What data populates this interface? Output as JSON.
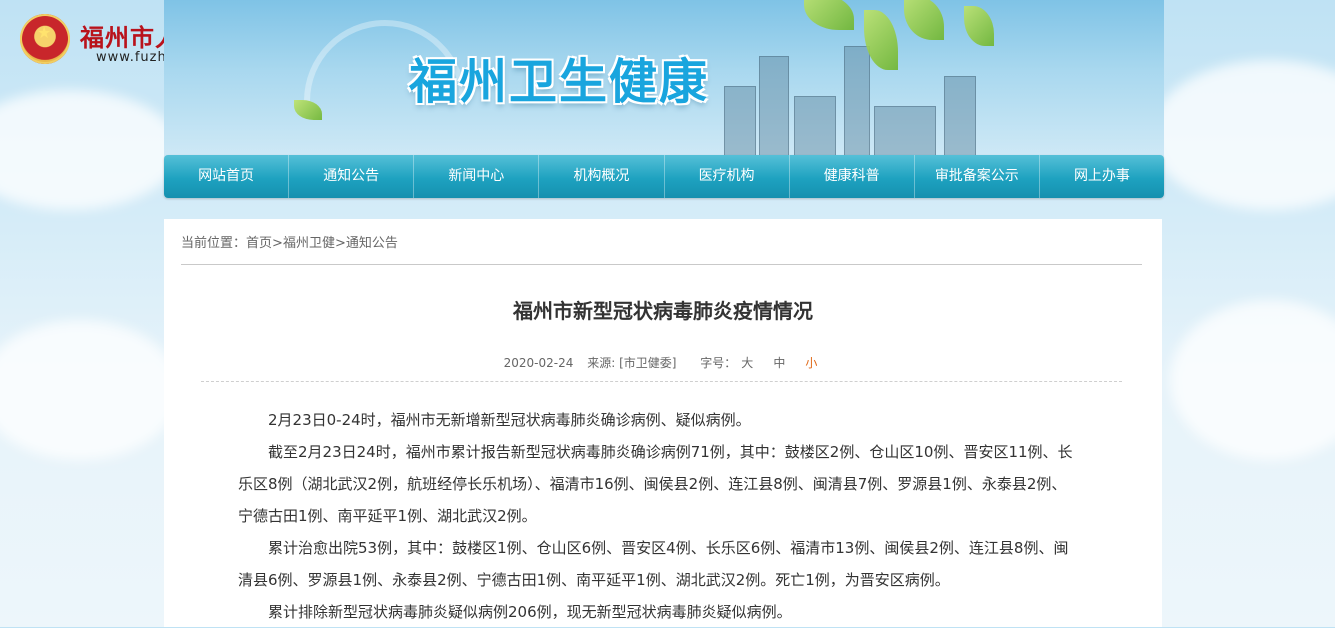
{
  "header": {
    "gov_name": "福州市人民政府",
    "gov_url": "www.fuzhou.gov.cn",
    "site_title": "福州卫生健康"
  },
  "nav": {
    "items": [
      "网站首页",
      "通知公告",
      "新闻中心",
      "机构概况",
      "医疗机构",
      "健康科普",
      "审批备案公示",
      "网上办事"
    ]
  },
  "breadcrumb": {
    "prefix": "当前位置：",
    "home": "首页",
    "sep1": ">",
    "section": "福州卫健",
    "sep2": ">",
    "page": "通知公告"
  },
  "article": {
    "title": "福州市新型冠状病毒肺炎疫情情况",
    "date": "2020-02-24",
    "source": "来源: [市卫健委]",
    "font_label": "字号：",
    "font_large": "大",
    "font_medium": "中",
    "font_small": "小",
    "paragraphs": [
      "2月23日0-24时，福州市无新增新型冠状病毒肺炎确诊病例、疑似病例。",
      "截至2月23日24时，福州市累计报告新型冠状病毒肺炎确诊病例71例，其中：鼓楼区2例、仓山区10例、晋安区11例、长乐区8例（湖北武汉2例，航班经停长乐机场）、福清市16例、闽侯县2例、连江县8例、闽清县7例、罗源县1例、永泰县2例、宁德古田1例、南平延平1例、湖北武汉2例。",
      "累计治愈出院53例，其中：鼓楼区1例、仓山区6例、晋安区4例、长乐区6例、福清市13例、闽侯县2例、连江县8例、闽清县6例、罗源县1例、永泰县2例、宁德古田1例、南平延平1例、湖北武汉2例。死亡1例，为晋安区病例。",
      "累计排除新型冠状病毒肺炎疑似病例206例，现无新型冠状病毒肺炎疑似病例。"
    ]
  },
  "colors": {
    "nav": "#1ea2c0",
    "gov_red": "#b9121b",
    "title_blue": "#19a5de",
    "active_font": "#e06a1a"
  }
}
